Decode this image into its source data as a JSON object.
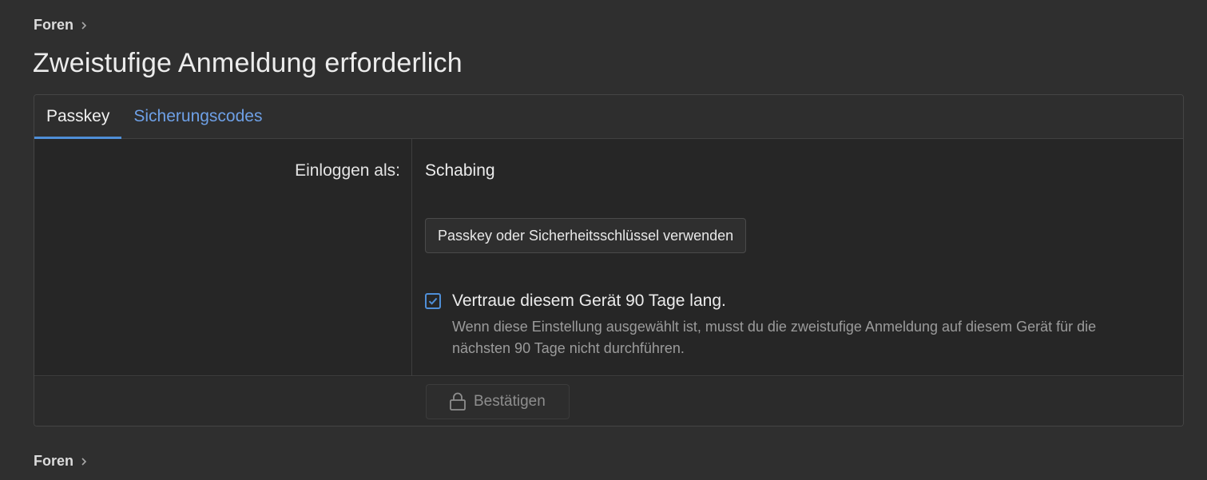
{
  "breadcrumb_top": {
    "label": "Foren",
    "icon": "chevron-right-icon"
  },
  "page": {
    "title": "Zweistufige Anmeldung erforderlich"
  },
  "tabs": [
    {
      "label": "Passkey",
      "active": true
    },
    {
      "label": "Sicherungscodes",
      "active": false
    }
  ],
  "form": {
    "login_label": "Einloggen als:",
    "username": "Schabing",
    "passkey_button": "Passkey oder Sicherheitsschlüssel verwenden",
    "trust": {
      "checked": true,
      "label": "Vertraue diesem Gerät 90 Tage lang.",
      "hint": "Wenn diese Einstellung ausgewählt ist, musst du die zweistufige Anmeldung auf diesem Gerät für die nächsten 90 Tage nicht durchführen."
    },
    "confirm_button": {
      "label": "Bestätigen",
      "icon": "lock-icon",
      "disabled": true
    }
  },
  "breadcrumb_bottom": {
    "label": "Foren",
    "icon": "chevron-right-icon"
  },
  "colors": {
    "background": "#2f2f2f",
    "panel": "#262626",
    "accent": "#4f8fd8",
    "link": "#6ea0e6",
    "hint_text": "#9b9b9b"
  }
}
